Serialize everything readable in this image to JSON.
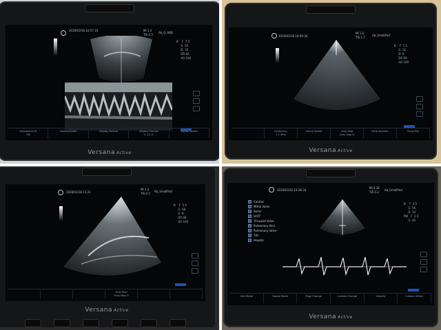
{
  "brand": {
    "name": "Versana",
    "model": "Active"
  },
  "colors": {
    "screen": "#050607",
    "bezel": "#151617",
    "softkey_text": "#93a7b6",
    "select_blue": "#1b52b8"
  },
  "panels": [
    {
      "id": "m-mode",
      "date": "2020/03/16 10:57:33",
      "preset": "Ab_G_ABD",
      "mi": "MI 1.2",
      "tis": "TIS 0.3",
      "softkeys": [
        "Anatomical M",
        "Sweep Speed",
        "Display Format",
        "Display Format",
        "Sweep Speed"
      ],
      "softkey_values": [
        "Off",
        "",
        "",
        "V 1/2 H",
        ""
      ]
    },
    {
      "id": "sector-b-mode",
      "date": "2020/03/16 10:09:34",
      "preset": "Ab_SmallPart",
      "mi": "MI 1.2",
      "tis": "TIS 1.7",
      "softkeys": [
        "",
        "Frequency",
        "Sound Speed",
        "Gray Map",
        "Focal Number",
        "Focal Pos"
      ],
      "softkey_values": [
        "",
        "7.2 MHz",
        "",
        "Gray Map D",
        "",
        ""
      ]
    },
    {
      "id": "sector-lung",
      "date": "2020/03/16 11:21",
      "preset": "Ab_SmallPart",
      "mi": "MI 1.2",
      "tis": "TIS 0.3",
      "softkeys": [
        "",
        "",
        "",
        "Gray Map",
        "",
        ""
      ],
      "softkey_values": [
        "",
        "",
        "",
        "Gray Map D",
        "",
        ""
      ]
    },
    {
      "id": "doppler",
      "date": "2020/03/16 10:28:34",
      "preset": "Ab_SmallPart",
      "mi": "MI 0.34",
      "tis": "TIS 0.2",
      "menu": [
        "Cardiac",
        "Mitral Valve",
        "Aortic",
        "LVOT",
        "Tricuspid Valve",
        "Pulmonary Vein",
        "Pulmonary Valve",
        "TDI",
        "Hepatic"
      ],
      "softkeys": [
        "SAX Mode",
        "Sweep Mode",
        "Page Change",
        "Custom Change",
        "Velocity",
        "Custom Select"
      ],
      "softkey_values": [
        "",
        "",
        "",
        "",
        "",
        ""
      ]
    }
  ]
}
